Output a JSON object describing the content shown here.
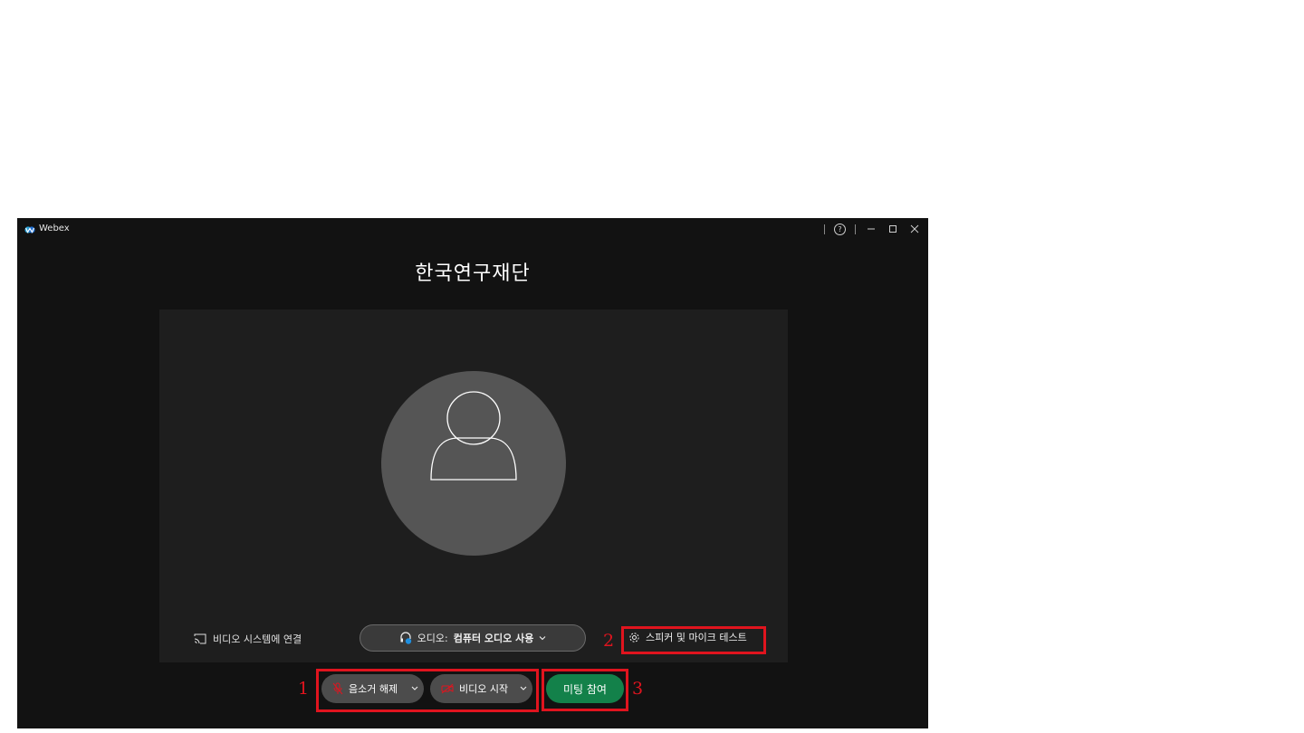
{
  "window": {
    "app_name": "Webex",
    "help_symbol": "?",
    "controls": [
      "minimize-icon",
      "maximize-icon",
      "close-icon"
    ]
  },
  "meeting": {
    "title": "한국연구재단"
  },
  "preview": {
    "video_system_label": "비디오 시스템에 연결",
    "audio_prefix": "오디오:",
    "audio_value": "컴퓨터 오디오 사용",
    "speaker_test_label": "스피커 및 마이크 테스트"
  },
  "controls": {
    "mute_label": "음소거 해제",
    "video_label": "비디오 시작",
    "join_label": "미팅 참여"
  },
  "annotations": {
    "mark1": "1",
    "mark2": "2",
    "mark3": "3",
    "highlight_color": "#e0141e"
  },
  "colors": {
    "window_bg": "#121212",
    "preview_bg": "#1e1e1e",
    "join_button": "#13814a",
    "muted_icon": "#e0141e"
  }
}
